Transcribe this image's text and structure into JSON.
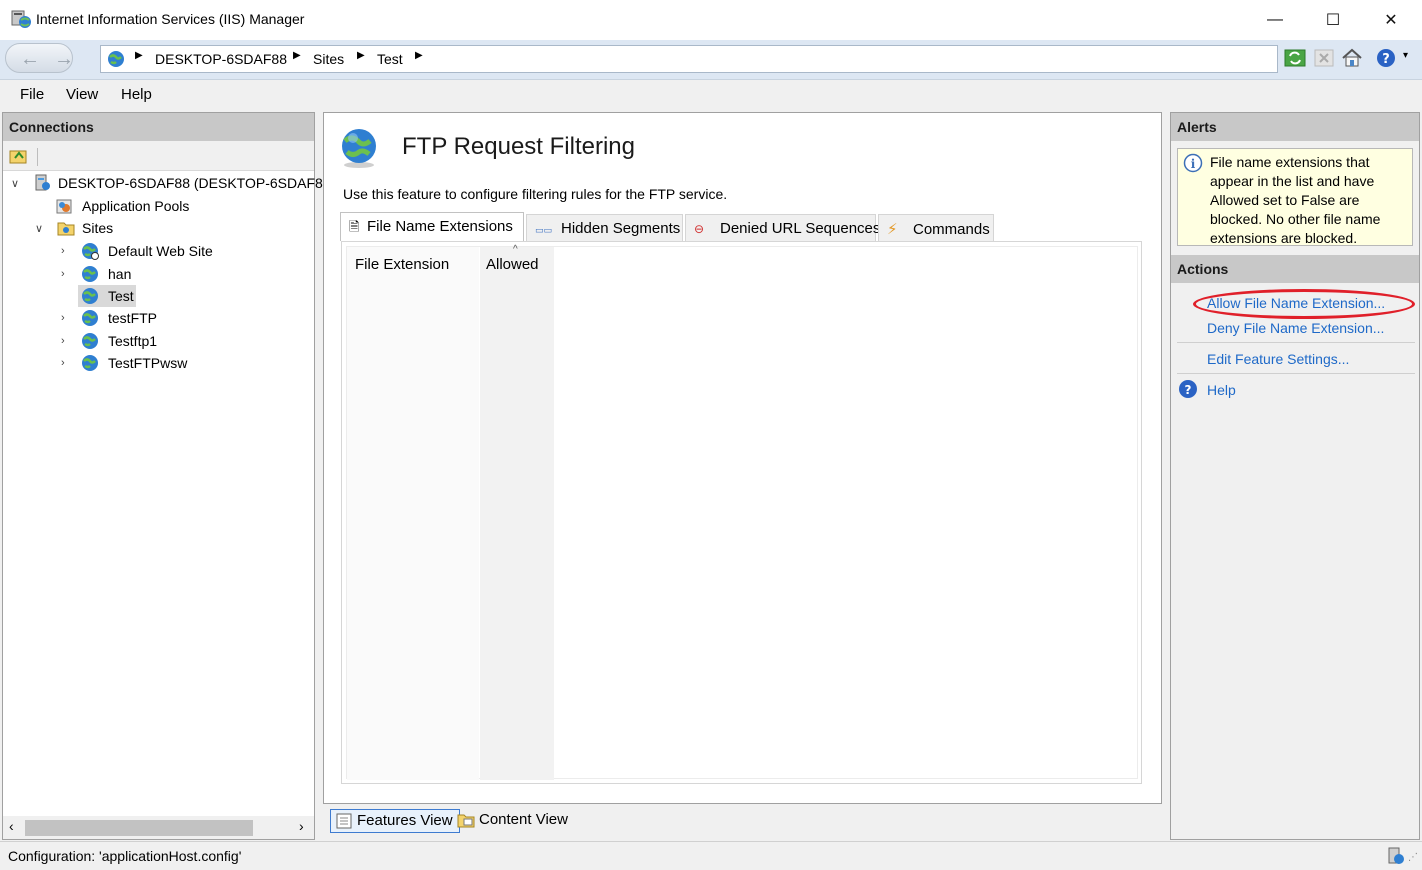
{
  "window": {
    "title": "Internet Information Services (IIS) Manager",
    "minimize": "—",
    "maximize": "☐",
    "close": "✕"
  },
  "address": {
    "crumbs": [
      "DESKTOP-6SDAF88",
      "Sites",
      "Test"
    ]
  },
  "menu": {
    "file": "File",
    "view": "View",
    "help": "Help"
  },
  "connections": {
    "header": "Connections",
    "tree": {
      "server": "DESKTOP-6SDAF88 (DESKTOP-6SDAF88",
      "app_pools": "Application Pools",
      "sites": "Sites",
      "site_items": [
        "Default Web Site",
        "han",
        "Test",
        "testFTP",
        "Testftp1",
        "TestFTPwsw"
      ],
      "selected": "Test"
    }
  },
  "feature": {
    "title": "FTP Request Filtering",
    "description": "Use this feature to configure filtering rules for the FTP service.",
    "tabs": [
      "File Name Extensions",
      "Hidden Segments",
      "Denied URL Sequences",
      "Commands"
    ],
    "active_tab": "File Name Extensions",
    "columns": [
      "File Extension",
      "Allowed"
    ]
  },
  "views": {
    "features": "Features View",
    "content": "Content View"
  },
  "alerts": {
    "header": "Alerts",
    "message": "File name extensions that appear in the list and have Allowed set to False are blocked. No other file name extensions are blocked."
  },
  "actions": {
    "header": "Actions",
    "allow": "Allow File Name Extension...",
    "deny": "Deny File Name Extension...",
    "edit": "Edit Feature Settings...",
    "help": "Help"
  },
  "status": {
    "text": "Configuration: 'applicationHost.config'"
  },
  "colors": {
    "accent": "#1e69c8",
    "highlight_ring": "#e0202a",
    "alert_bg": "#ffffe1"
  }
}
